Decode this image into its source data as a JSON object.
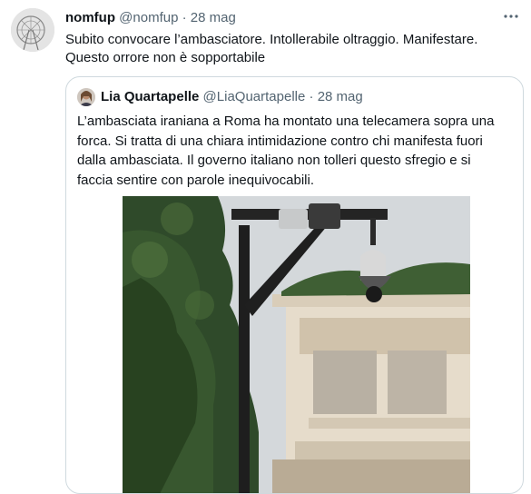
{
  "tweet": {
    "author_name": "nomfup",
    "author_handle": "@nomfup",
    "separator": "·",
    "date": "28 mag",
    "more_icon": "ellipsis-icon",
    "text_line1": "Subito convocare l’ambasciatore. Intollerabile oltraggio. Manifestare.",
    "text_line2": "Questo orrore non è sopportabile"
  },
  "quoted": {
    "author_name": "Lia Quartapelle",
    "author_handle": "@LiaQuartapelle",
    "separator": "·",
    "date": "28 mag",
    "text_lines": [
      "L’ambasciata iraniana a Roma ha montato una telecamera sopra una",
      "forca. Si tratta di una chiara intimidazione contro chi manifesta fuori",
      "dalla ambasciata. Il governo italiano non tolleri questo sfregio e si",
      "faccia sentire con parole inequivocabili."
    ]
  },
  "colors": {
    "text_primary": "#0f1419",
    "text_secondary": "#536471",
    "border": "#cfd9de"
  }
}
